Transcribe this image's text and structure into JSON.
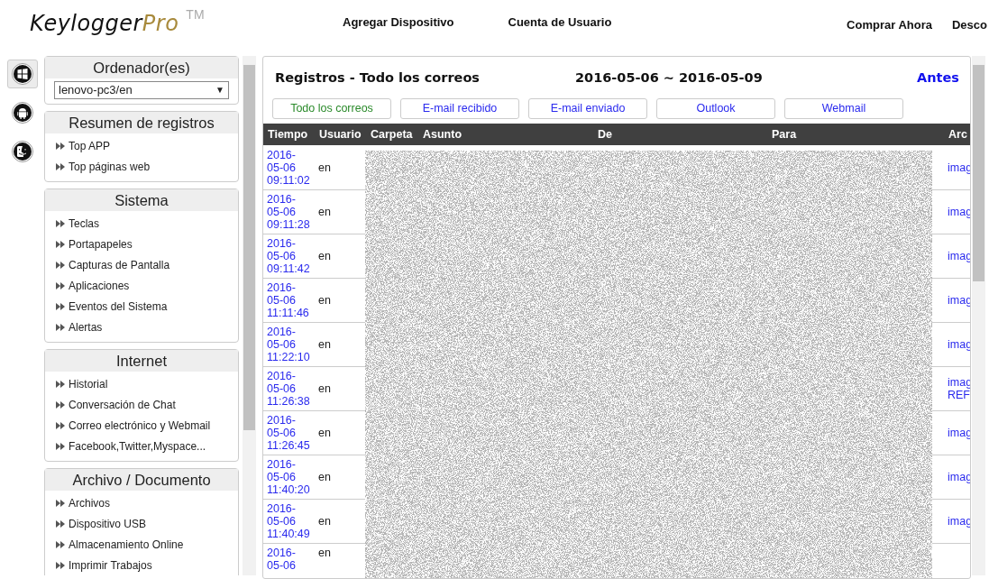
{
  "header": {
    "logo": {
      "word": "Keylogger",
      "accent": "Pro",
      "mark": "TM"
    },
    "nav": [
      "Agregar Dispositivo",
      "Cuenta de Usuario"
    ],
    "right_nav": [
      "Comprar Ahora",
      "Desco"
    ]
  },
  "platforms": [
    {
      "kind": "windows",
      "selected": true
    },
    {
      "kind": "android",
      "selected": false
    },
    {
      "kind": "mac",
      "selected": false
    }
  ],
  "computers": {
    "title": "Ordenador(es)",
    "value": "lenovo-pc3/en",
    "caret": "▼"
  },
  "sections": [
    {
      "title": "Resumen de registros",
      "items": [
        "Top APP",
        "Top páginas web"
      ]
    },
    {
      "title": "Sistema",
      "items": [
        "Teclas",
        "Portapapeles",
        "Capturas de Pantalla",
        "Aplicaciones",
        "Eventos del Sistema",
        "Alertas"
      ]
    },
    {
      "title": "Internet",
      "items": [
        "Historial",
        "Conversación de Chat",
        "Correo electrónico y Webmail",
        "Facebook,Twitter,Myspace..."
      ]
    },
    {
      "title": "Archivo / Documento",
      "items": [
        "Archivos",
        "Dispositivo USB",
        "Almacenamiento Online",
        "Imprimir Trabajos"
      ]
    }
  ],
  "main": {
    "title": "Registros - Todo los correos",
    "range": "2016-05-06 ~ 2016-05-09",
    "back": "Antes",
    "filters": [
      {
        "label": "Todo los correos",
        "selected": true
      },
      {
        "label": "E-mail recibido",
        "selected": false
      },
      {
        "label": "E-mail enviado",
        "selected": false
      },
      {
        "label": "Outlook",
        "selected": false
      },
      {
        "label": "Webmail",
        "selected": false
      }
    ],
    "table": {
      "columns": [
        "Tiempo",
        "Usuario",
        "Carpeta",
        "Asunto",
        "De",
        "Para",
        "Arc"
      ],
      "rows": [
        {
          "time": "2016-05-06 09:11:02",
          "user": "en",
          "files": [
            "imag"
          ]
        },
        {
          "time": "2016-05-06 09:11:28",
          "user": "en",
          "files": [
            "imag"
          ]
        },
        {
          "time": "2016-05-06 09:11:42",
          "user": "en",
          "files": [
            "imag"
          ]
        },
        {
          "time": "2016-05-06 11:11:46",
          "user": "en",
          "files": [
            "imag"
          ]
        },
        {
          "time": "2016-05-06 11:22:10",
          "user": "en",
          "files": [
            "imag"
          ]
        },
        {
          "time": "2016-05-06 11:26:38",
          "user": "en",
          "files": [
            "imag",
            "REF"
          ]
        },
        {
          "time": "2016-05-06 11:26:45",
          "user": "en",
          "files": [
            "imag"
          ]
        },
        {
          "time": "2016-05-06 11:40:20",
          "user": "en",
          "files": [
            "imag"
          ]
        },
        {
          "time": "2016-05-06 11:40:49",
          "user": "en",
          "files": [
            "imag"
          ]
        },
        {
          "time": "2016-05-06",
          "user": "en"
        }
      ]
    }
  }
}
